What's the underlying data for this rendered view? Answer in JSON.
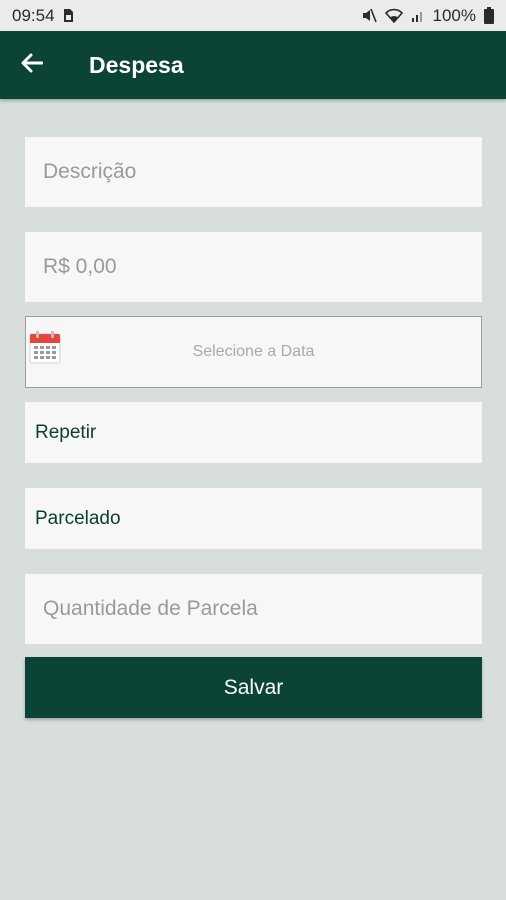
{
  "status_bar": {
    "time": "09:54",
    "battery": "100%",
    "icons": [
      "sim-icon",
      "mute-icon",
      "wifi-icon",
      "signal-icon",
      "battery-icon"
    ]
  },
  "app_bar": {
    "title": "Despesa",
    "back_icon": "arrow-left-icon",
    "color": "#0b4437"
  },
  "form": {
    "descricao_placeholder": "Descrição",
    "valor_placeholder": "R$ 0,00",
    "data_label": "Selecione a Data",
    "data_icon": "calendar-icon",
    "repetir_label": "Repetir",
    "parcelado_label": "Parcelado",
    "quantidade_placeholder": "Quantidade de Parcela",
    "save_label": "Salvar"
  }
}
